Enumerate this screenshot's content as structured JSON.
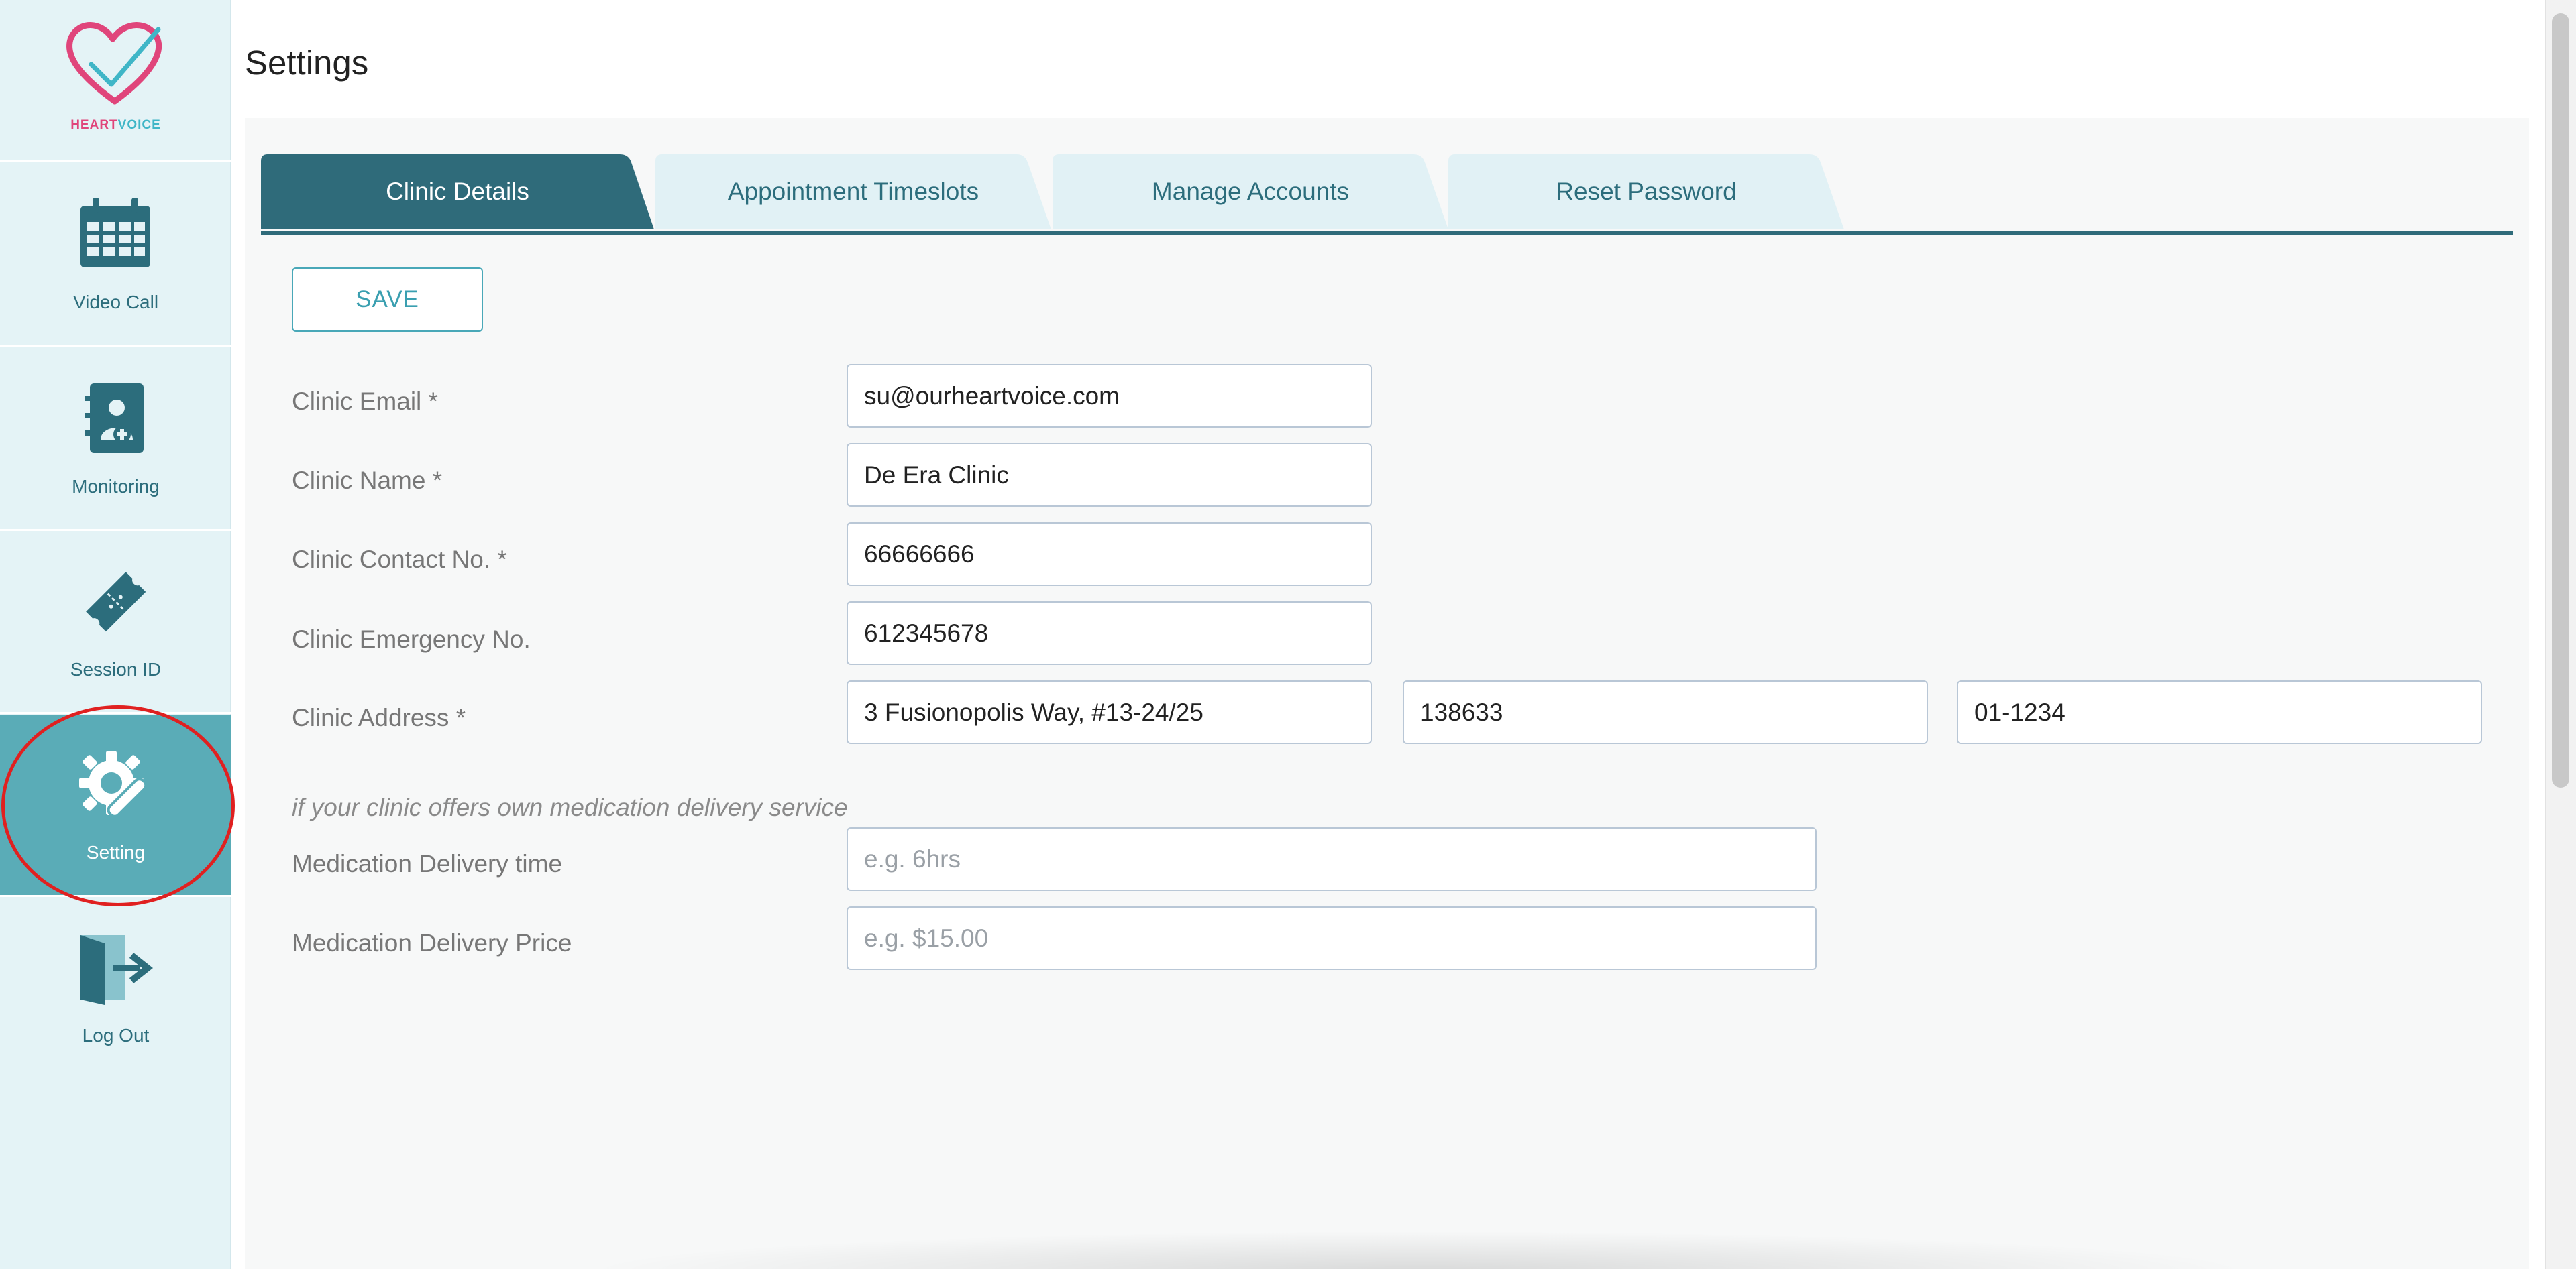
{
  "brand": {
    "logo_part1": "HEART",
    "logo_part2": "VOICE",
    "heart_color": "#e0457b",
    "accent_color": "#3fb6c7"
  },
  "sidebar": {
    "items": [
      {
        "label": "Video Call",
        "icon": "calendar-icon"
      },
      {
        "label": "Monitoring",
        "icon": "medical-book-icon"
      },
      {
        "label": "Session ID",
        "icon": "ticket-icon"
      },
      {
        "label": "Setting",
        "icon": "settings-wrench-icon",
        "active": true
      },
      {
        "label": "Log Out",
        "icon": "logout-icon"
      }
    ]
  },
  "page": {
    "title": "Settings"
  },
  "tabs": [
    {
      "label": "Clinic Details",
      "active": true
    },
    {
      "label": "Appointment Timeslots"
    },
    {
      "label": "Manage Accounts"
    },
    {
      "label": "Reset Password"
    }
  ],
  "form": {
    "save_label": "SAVE",
    "clinic_email": {
      "label": "Clinic Email *",
      "value": "su@ourheartvoice.com"
    },
    "clinic_name": {
      "label": "Clinic Name *",
      "value": "De Era Clinic"
    },
    "clinic_contact": {
      "label": "Clinic Contact No. *",
      "value": "66666666"
    },
    "clinic_emergency": {
      "label": "Clinic Emergency No.",
      "value": "612345678"
    },
    "clinic_address": {
      "label": "Clinic Address *",
      "street": "3 Fusionopolis Way, #13-24/25",
      "postal": "138633",
      "unit": "01-1234"
    },
    "delivery_note": "if your clinic offers own medication delivery service",
    "delivery_time": {
      "label": "Medication Delivery time",
      "placeholder": "e.g. 6hrs"
    },
    "delivery_price": {
      "label": "Medication Delivery Price",
      "placeholder": "e.g. $15.00"
    }
  },
  "colors": {
    "tab_active": "#2f6b7a",
    "tab_inactive": "#e1f1f5",
    "sidebar_bg": "#e4f3f6",
    "sidebar_active": "#5aacb7",
    "highlight": "#e02020"
  }
}
